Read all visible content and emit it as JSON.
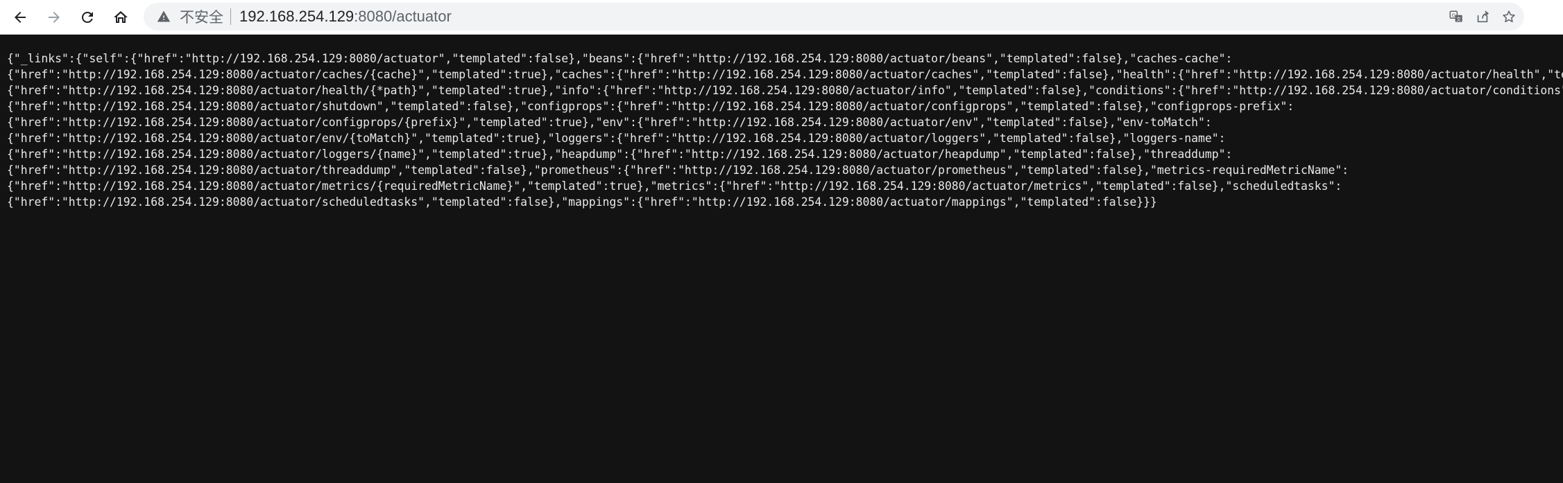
{
  "browser": {
    "security_label": "不安全",
    "url_host": "192.168.254.129",
    "url_path": ":8080/actuator",
    "icons": {
      "back": "back-arrow-icon",
      "forward": "forward-arrow-icon",
      "reload": "reload-icon",
      "home": "home-icon",
      "warning": "warning-triangle-icon",
      "translate": "translate-icon",
      "share": "share-icon",
      "bookmark": "star-icon"
    }
  },
  "content": {
    "lines": [
      "{\"_links\":{\"self\":{\"href\":\"http://192.168.254.129:8080/actuator\",\"templated\":false},\"beans\":{\"href\":\"http://192.168.254.129:8080/actuator/beans\",\"templated\":false},\"caches-cache\":",
      "{\"href\":\"http://192.168.254.129:8080/actuator/caches/{cache}\",\"templated\":true},\"caches\":{\"href\":\"http://192.168.254.129:8080/actuator/caches\",\"templated\":false},\"health\":{\"href\":\"http://192.168.254.129:8080/actuator/health\",\"temp",
      "{\"href\":\"http://192.168.254.129:8080/actuator/health/{*path}\",\"templated\":true},\"info\":{\"href\":\"http://192.168.254.129:8080/actuator/info\",\"templated\":false},\"conditions\":{\"href\":\"http://192.168.254.129:8080/actuator/conditions\",\"",
      "{\"href\":\"http://192.168.254.129:8080/actuator/shutdown\",\"templated\":false},\"configprops\":{\"href\":\"http://192.168.254.129:8080/actuator/configprops\",\"templated\":false},\"configprops-prefix\":",
      "{\"href\":\"http://192.168.254.129:8080/actuator/configprops/{prefix}\",\"templated\":true},\"env\":{\"href\":\"http://192.168.254.129:8080/actuator/env\",\"templated\":false},\"env-toMatch\":",
      "{\"href\":\"http://192.168.254.129:8080/actuator/env/{toMatch}\",\"templated\":true},\"loggers\":{\"href\":\"http://192.168.254.129:8080/actuator/loggers\",\"templated\":false},\"loggers-name\":",
      "{\"href\":\"http://192.168.254.129:8080/actuator/loggers/{name}\",\"templated\":true},\"heapdump\":{\"href\":\"http://192.168.254.129:8080/actuator/heapdump\",\"templated\":false},\"threaddump\":",
      "{\"href\":\"http://192.168.254.129:8080/actuator/threaddump\",\"templated\":false},\"prometheus\":{\"href\":\"http://192.168.254.129:8080/actuator/prometheus\",\"templated\":false},\"metrics-requiredMetricName\":",
      "{\"href\":\"http://192.168.254.129:8080/actuator/metrics/{requiredMetricName}\",\"templated\":true},\"metrics\":{\"href\":\"http://192.168.254.129:8080/actuator/metrics\",\"templated\":false},\"scheduledtasks\":",
      "{\"href\":\"http://192.168.254.129:8080/actuator/scheduledtasks\",\"templated\":false},\"mappings\":{\"href\":\"http://192.168.254.129:8080/actuator/mappings\",\"templated\":false}}}"
    ]
  }
}
